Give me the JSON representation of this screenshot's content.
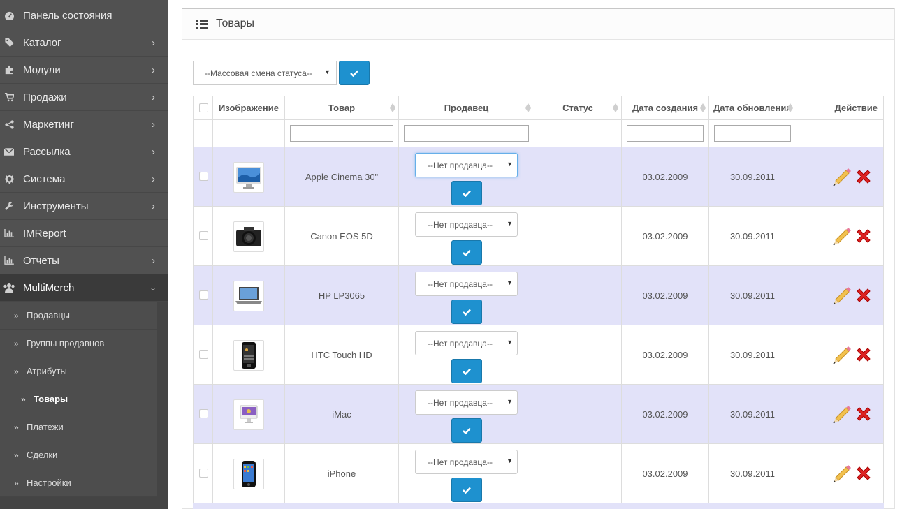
{
  "sidebar": {
    "items": [
      {
        "label": "Панель состояния",
        "icon": "dashboard-icon",
        "chevron": false
      },
      {
        "label": "Каталог",
        "icon": "tags-icon",
        "chevron": true
      },
      {
        "label": "Модули",
        "icon": "puzzle-icon",
        "chevron": true
      },
      {
        "label": "Продажи",
        "icon": "cart-icon",
        "chevron": true
      },
      {
        "label": "Маркетинг",
        "icon": "share-icon",
        "chevron": true
      },
      {
        "label": "Рассылка",
        "icon": "envelope-icon",
        "chevron": true
      },
      {
        "label": "Система",
        "icon": "gear-icon",
        "chevron": true
      },
      {
        "label": "Инструменты",
        "icon": "wrench-icon",
        "chevron": true
      },
      {
        "label": "IMReport",
        "icon": "bar-chart-icon",
        "chevron": false
      },
      {
        "label": "Отчеты",
        "icon": "bar-chart-icon",
        "chevron": true
      },
      {
        "label": "MultiMerch",
        "icon": "users-icon",
        "chevron": true,
        "expanded": true
      }
    ],
    "submenu": [
      {
        "label": "Продавцы"
      },
      {
        "label": "Группы продавцов"
      },
      {
        "label": "Атрибуты"
      },
      {
        "label": "Товары",
        "active": true
      },
      {
        "label": "Платежи"
      },
      {
        "label": "Сделки"
      },
      {
        "label": "Настройки"
      }
    ]
  },
  "panel": {
    "title": "Товары",
    "mass_status_placeholder": "--Массовая смена статуса--"
  },
  "table": {
    "columns": [
      "Изображение",
      "Товар",
      "Продавец",
      "Статус",
      "Дата создания",
      "Дата обновления",
      "Действие"
    ],
    "rows": [
      {
        "product": "Apple Cinema 30\"",
        "image": "monitor-image",
        "seller": "--Нет продавца--",
        "status": "",
        "created": "03.02.2009",
        "updated": "30.09.2011"
      },
      {
        "product": "Canon EOS 5D",
        "image": "camera-image",
        "seller": "--Нет продавца--",
        "status": "",
        "created": "03.02.2009",
        "updated": "30.09.2011"
      },
      {
        "product": "HP LP3065",
        "image": "laptop-image",
        "seller": "--Нет продавца--",
        "status": "",
        "created": "03.02.2009",
        "updated": "30.09.2011"
      },
      {
        "product": "HTC Touch HD",
        "image": "phone-image",
        "seller": "--Нет продавца--",
        "status": "",
        "created": "03.02.2009",
        "updated": "30.09.2011"
      },
      {
        "product": "iMac",
        "image": "imac-image",
        "seller": "--Нет продавца--",
        "status": "",
        "created": "03.02.2009",
        "updated": "30.09.2011"
      },
      {
        "product": "iPhone",
        "image": "iphone-image",
        "seller": "--Нет продавца--",
        "status": "",
        "created": "03.02.2009",
        "updated": "30.09.2011"
      }
    ]
  },
  "colors": {
    "accent": "#1e91cf",
    "row_highlight": "#e2e2f9",
    "sidebar_bg": "#515151"
  }
}
